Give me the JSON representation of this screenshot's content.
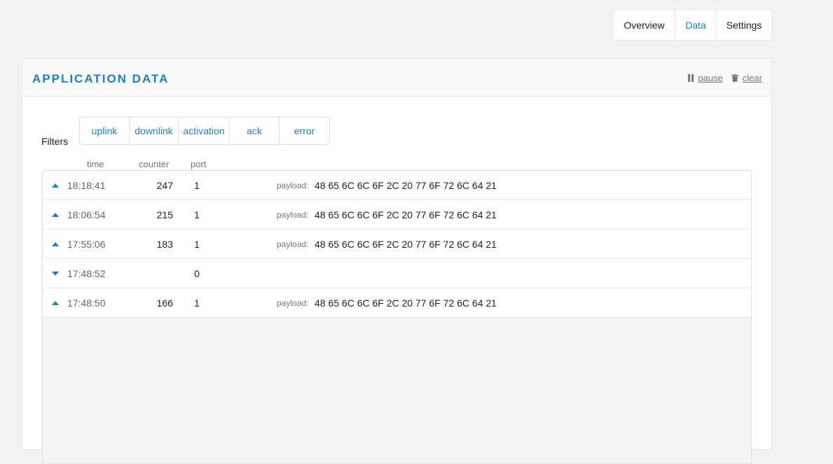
{
  "tabs": [
    {
      "label": "Overview",
      "active": false
    },
    {
      "label": "Data",
      "active": true
    },
    {
      "label": "Settings",
      "active": false
    }
  ],
  "card": {
    "title": "APPLICATION DATA",
    "pause_label": "pause",
    "clear_label": "clear"
  },
  "filters": {
    "label": "Filters",
    "items": [
      "uplink",
      "downlink",
      "activation",
      "ack",
      "error"
    ]
  },
  "columns": {
    "time": "time",
    "counter": "counter",
    "port": "port"
  },
  "rows": [
    {
      "direction": "up",
      "time": "18:18:41",
      "counter": "247",
      "port": "1",
      "payload_label": "payload:",
      "payload": "48 65 6C 6C 6F 2C 20 77 6F 72 6C 64 21"
    },
    {
      "direction": "up",
      "time": "18:06:54",
      "counter": "215",
      "port": "1",
      "payload_label": "payload:",
      "payload": "48 65 6C 6C 6F 2C 20 77 6F 72 6C 64 21"
    },
    {
      "direction": "up",
      "time": "17:55:06",
      "counter": "183",
      "port": "1",
      "payload_label": "payload:",
      "payload": "48 65 6C 6C 6F 2C 20 77 6F 72 6C 64 21"
    },
    {
      "direction": "down",
      "time": "17:48:52",
      "counter": "",
      "port": "0",
      "payload_label": "",
      "payload": ""
    },
    {
      "direction": "up",
      "time": "17:48:50",
      "counter": "166",
      "port": "1",
      "payload_label": "payload:",
      "payload": "48 65 6C 6C 6F 2C 20 77 6F 72 6C 64 21"
    }
  ],
  "colors": {
    "accent": "#1e7ec8"
  },
  "icons": {
    "pause": "pause-icon",
    "clear": "trash-icon",
    "uplink": "caret-up-icon",
    "downlink": "caret-down-icon"
  }
}
